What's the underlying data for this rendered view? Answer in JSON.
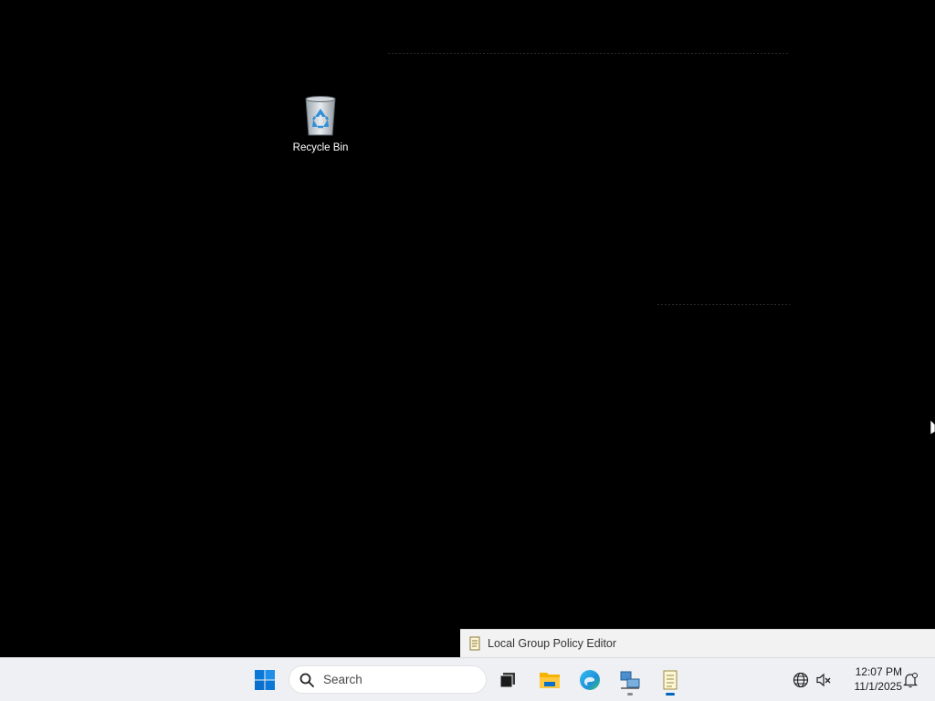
{
  "desktop": {
    "icons": [
      {
        "label": "Recycle Bin",
        "icon": "recycle-bin-icon"
      }
    ],
    "background_color": "#000000"
  },
  "taskbar_preview": {
    "title": "Local Group Policy Editor",
    "icon": "group-policy-icon"
  },
  "taskbar": {
    "start_icon": "windows-start-icon",
    "search": {
      "placeholder": "Search",
      "icon": "search-icon"
    },
    "apps": [
      {
        "name": "Task View",
        "icon": "task-view-icon",
        "running": false
      },
      {
        "name": "File Explorer",
        "icon": "folder-icon",
        "running": false
      },
      {
        "name": "Microsoft Edge",
        "icon": "edge-icon",
        "running": false
      },
      {
        "name": "Network app",
        "icon": "network-computer-icon",
        "running": true,
        "active": false
      },
      {
        "name": "Local Group Policy Editor",
        "icon": "group-policy-icon",
        "running": true,
        "active": true
      }
    ],
    "tray": {
      "icons": [
        "globe-icon",
        "speaker-muted-icon",
        "notification-bell-icon"
      ],
      "time": "12:07 PM",
      "date": "11/1/2025"
    },
    "accent_color": "#0067c0",
    "background_color": "#eef0f3"
  }
}
